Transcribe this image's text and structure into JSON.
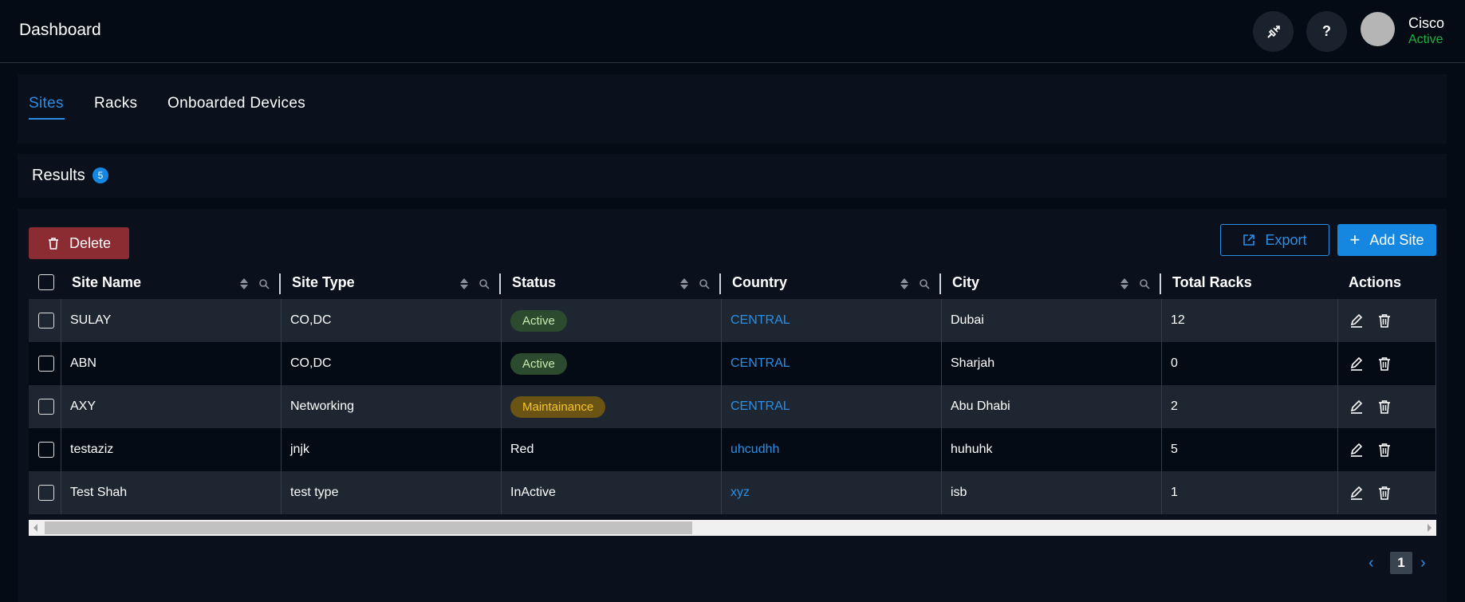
{
  "app": {
    "title": "Dashboard"
  },
  "user": {
    "name": "Cisco",
    "status": "Active"
  },
  "tabs": [
    {
      "label": "Sites",
      "active": true
    },
    {
      "label": "Racks",
      "active": false
    },
    {
      "label": "Onboarded Devices",
      "active": false
    }
  ],
  "results": {
    "label": "Results",
    "count": "5"
  },
  "toolbar": {
    "delete_label": "Delete",
    "export_label": "Export",
    "add_label": "Add Site"
  },
  "columns": {
    "site_name": "Site Name",
    "site_type": "Site Type",
    "status": "Status",
    "country": "Country",
    "city": "City",
    "total_racks": "Total Racks",
    "actions": "Actions"
  },
  "rows": [
    {
      "site_name": "SULAY",
      "site_type": "CO,DC",
      "status": "Active",
      "status_style": "pill-active",
      "country": "CENTRAL",
      "city": "Dubai",
      "total_racks": "12"
    },
    {
      "site_name": "ABN",
      "site_type": "CO,DC",
      "status": "Active",
      "status_style": "pill-active",
      "country": "CENTRAL",
      "city": "Sharjah",
      "total_racks": "0"
    },
    {
      "site_name": "AXY",
      "site_type": "Networking",
      "status": "Maintainance",
      "status_style": "pill-maint",
      "country": "CENTRAL",
      "city": "Abu Dhabi",
      "total_racks": "2"
    },
    {
      "site_name": "testaziz",
      "site_type": "jnjk",
      "status": "Red",
      "status_style": "plain",
      "country": "uhcudhh",
      "city": "huhuhk",
      "total_racks": "5"
    },
    {
      "site_name": "Test Shah",
      "site_type": "test type",
      "status": "InActive",
      "status_style": "plain",
      "country": "xyz",
      "city": "isb",
      "total_racks": "1"
    }
  ],
  "pagination": {
    "current_page": "1",
    "prev_icon": "chevron-left-icon",
    "next_icon": "chevron-right-icon"
  },
  "colors": {
    "accent": "#2b8ee6",
    "danger": "#8b2b32",
    "success": "#1fb040",
    "warning": "#f5c426"
  }
}
